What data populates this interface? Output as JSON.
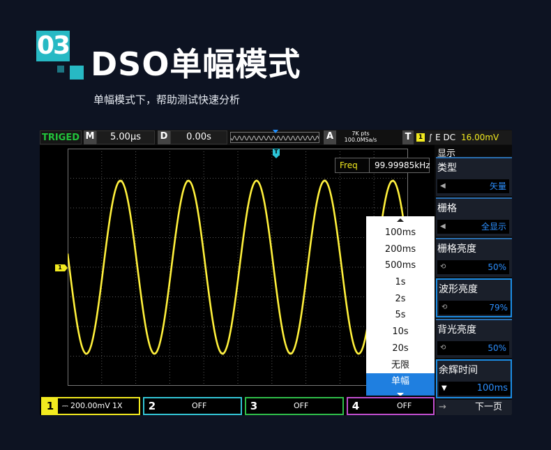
{
  "header": {
    "badge": "03",
    "title": "DSO单幅模式",
    "subtitle": "单幅模式下，帮助测试快速分析"
  },
  "topbar": {
    "trig_status": "TRIGED",
    "m_label": "M",
    "timebase": "5.00µs",
    "d_label": "D",
    "delay": "0.00s",
    "a_label": "A",
    "mem_depth": "7K pts",
    "sample_rate": "100.0MSa/s",
    "t_label": "T",
    "trig_channel": "1",
    "trig_type": "∫ E DC",
    "trig_level": "16.00mV"
  },
  "measure": {
    "label": "Freq",
    "value": "99.99985kHz"
  },
  "markers": {
    "trigger_marker": "T",
    "ch1_marker": "1"
  },
  "dropdown": {
    "items": [
      "100ms",
      "200ms",
      "500ms",
      "1s",
      "2s",
      "5s",
      "10s",
      "20s",
      "无限",
      "单幅"
    ],
    "selected": "单幅"
  },
  "right_menu": {
    "title": "显示",
    "items": [
      {
        "label": "类型",
        "value": "矢量"
      },
      {
        "label": "栅格",
        "value": "全显示"
      },
      {
        "label": "栅格亮度",
        "value": "50%"
      },
      {
        "label": "波形亮度",
        "value": "79%"
      },
      {
        "label": "背光亮度",
        "value": "50%"
      },
      {
        "label": "余辉时间",
        "value": "100ms"
      }
    ],
    "next_page": "下一页"
  },
  "channels": [
    {
      "num": "1",
      "text": "200.00mV",
      "probe": "1X",
      "color": "#f2ea1f"
    },
    {
      "num": "2",
      "text": "OFF",
      "color": "#33c6d6"
    },
    {
      "num": "3",
      "text": "OFF",
      "color": "#2fbf4a"
    },
    {
      "num": "4",
      "text": "OFF",
      "color": "#c24fd0"
    }
  ],
  "colors": {
    "accent": "#27b9c4",
    "waveform": "#ffef2a",
    "selection": "#1f7fe0"
  }
}
